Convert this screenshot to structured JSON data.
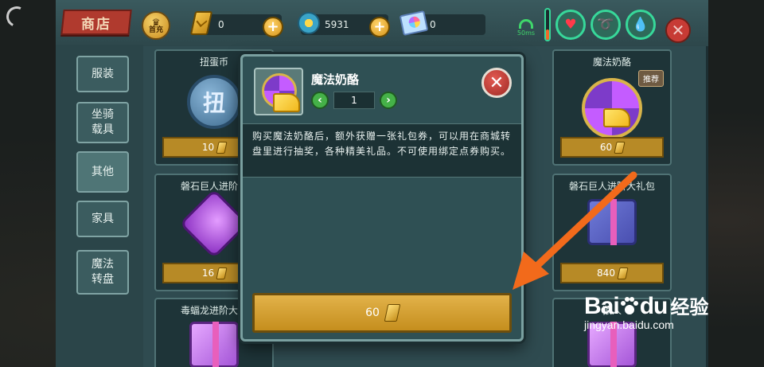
{
  "topbar": {
    "shop_title": "商店",
    "first_charge_label": "首充",
    "currencies": [
      {
        "name": "gold-bar",
        "value": "0"
      },
      {
        "name": "sun-coin",
        "value": "5931"
      },
      {
        "name": "wheel-ticket",
        "value": "0"
      }
    ],
    "ping": "50ms",
    "gauge_level_pct": 35,
    "vitals": [
      "health",
      "food",
      "water"
    ]
  },
  "sidebar": {
    "items": [
      {
        "label": "服装"
      },
      {
        "label": "坐骑\n载具"
      },
      {
        "label": "其他",
        "active": true
      },
      {
        "label": "家具"
      },
      {
        "label": "魔法\n转盘"
      }
    ]
  },
  "grid": {
    "items": [
      {
        "title": "扭蛋币",
        "price": "10",
        "art": "扭"
      },
      {
        "title": "魔法奶酪",
        "price": "60",
        "badge": "推荐"
      },
      {
        "title": "磐石巨人进阶礼",
        "price": "16"
      },
      {
        "title": "磐石巨人进阶大礼包",
        "price": "840"
      },
      {
        "title": "毒蝠龙进阶大礼",
        "price": ""
      },
      {
        "title": "狼人",
        "price": ""
      }
    ]
  },
  "modal": {
    "title": "魔法奶酪",
    "quantity": "1",
    "description": "购买魔法奶酪后，额外获赠一张礼包券，可以用在商城转盘里进行抽奖，各种精美礼品。不可使用绑定点券购买。",
    "buy_price": "60"
  },
  "watermark": {
    "brand_a": "Bai",
    "brand_b": "du",
    "brand_cn": "经验",
    "url": "jingyan.baidu.com"
  },
  "colors": {
    "accent_gold": "#c58e1e",
    "close_red": "#c73b35",
    "arrow_orange": "#f26a1b",
    "vital_ring": "#37d89a"
  }
}
